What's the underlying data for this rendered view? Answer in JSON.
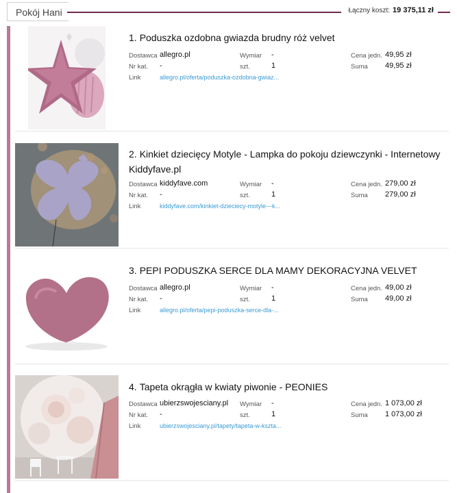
{
  "header": {
    "title": "Pokój Hani",
    "total_label": "Łączny koszt:",
    "total_value": "19 375,11 zł"
  },
  "labels": {
    "supplier": "Dostawca",
    "catalog": "Nr kat.",
    "link": "Link",
    "dimension": "Wymiar",
    "qty": "szt.",
    "unit_price": "Cena jedn.",
    "sum": "Suma"
  },
  "items": [
    {
      "num": "1.",
      "title": "Poduszka ozdobna gwiazda brudny róż velvet",
      "supplier": "allegro.pl",
      "catalog": "-",
      "link": "allegro.pl/oferta/poduszka-ozdobna-gwiaz...",
      "dimension": "-",
      "qty": "1",
      "unit_price": "49,95 zł",
      "sum": "49,95 zł"
    },
    {
      "num": "2.",
      "title": "Kinkiet dziecięcy Motyle - Lampka do pokoju dziewczynki - Internetowy Kiddyfave.pl",
      "supplier": "kiddyfave.com",
      "catalog": "-",
      "link": "kiddyfave.com/kinkiet-dzieciecy-motyle---k...",
      "dimension": "-",
      "qty": "1",
      "unit_price": "279,00 zł",
      "sum": "279,00 zł"
    },
    {
      "num": "3.",
      "title": "PEPI PODUSZKA SERCE DLA MAMY DEKORACYJNA VELVET",
      "supplier": "allegro.pl",
      "catalog": "-",
      "link": "allegro.pl/oferta/pepi-poduszka-serce-dla-...",
      "dimension": "-",
      "qty": "1",
      "unit_price": "49,00 zł",
      "sum": "49,00 zł"
    },
    {
      "num": "4.",
      "title": "Tapeta okrągła w kwiaty piwonie - PEONIES",
      "supplier": "ubierzswojesciany.pl",
      "catalog": "-",
      "link": "ubierzswojesciany.pl/tapety/tapeta-w-kszta...",
      "dimension": "-",
      "qty": "1",
      "unit_price": "1 073,00 zł",
      "sum": "1 073,00 zł"
    }
  ],
  "colors": {
    "accent": "#6d2a4b",
    "sidebar": "#b77b97",
    "link": "#3a9ad6"
  }
}
